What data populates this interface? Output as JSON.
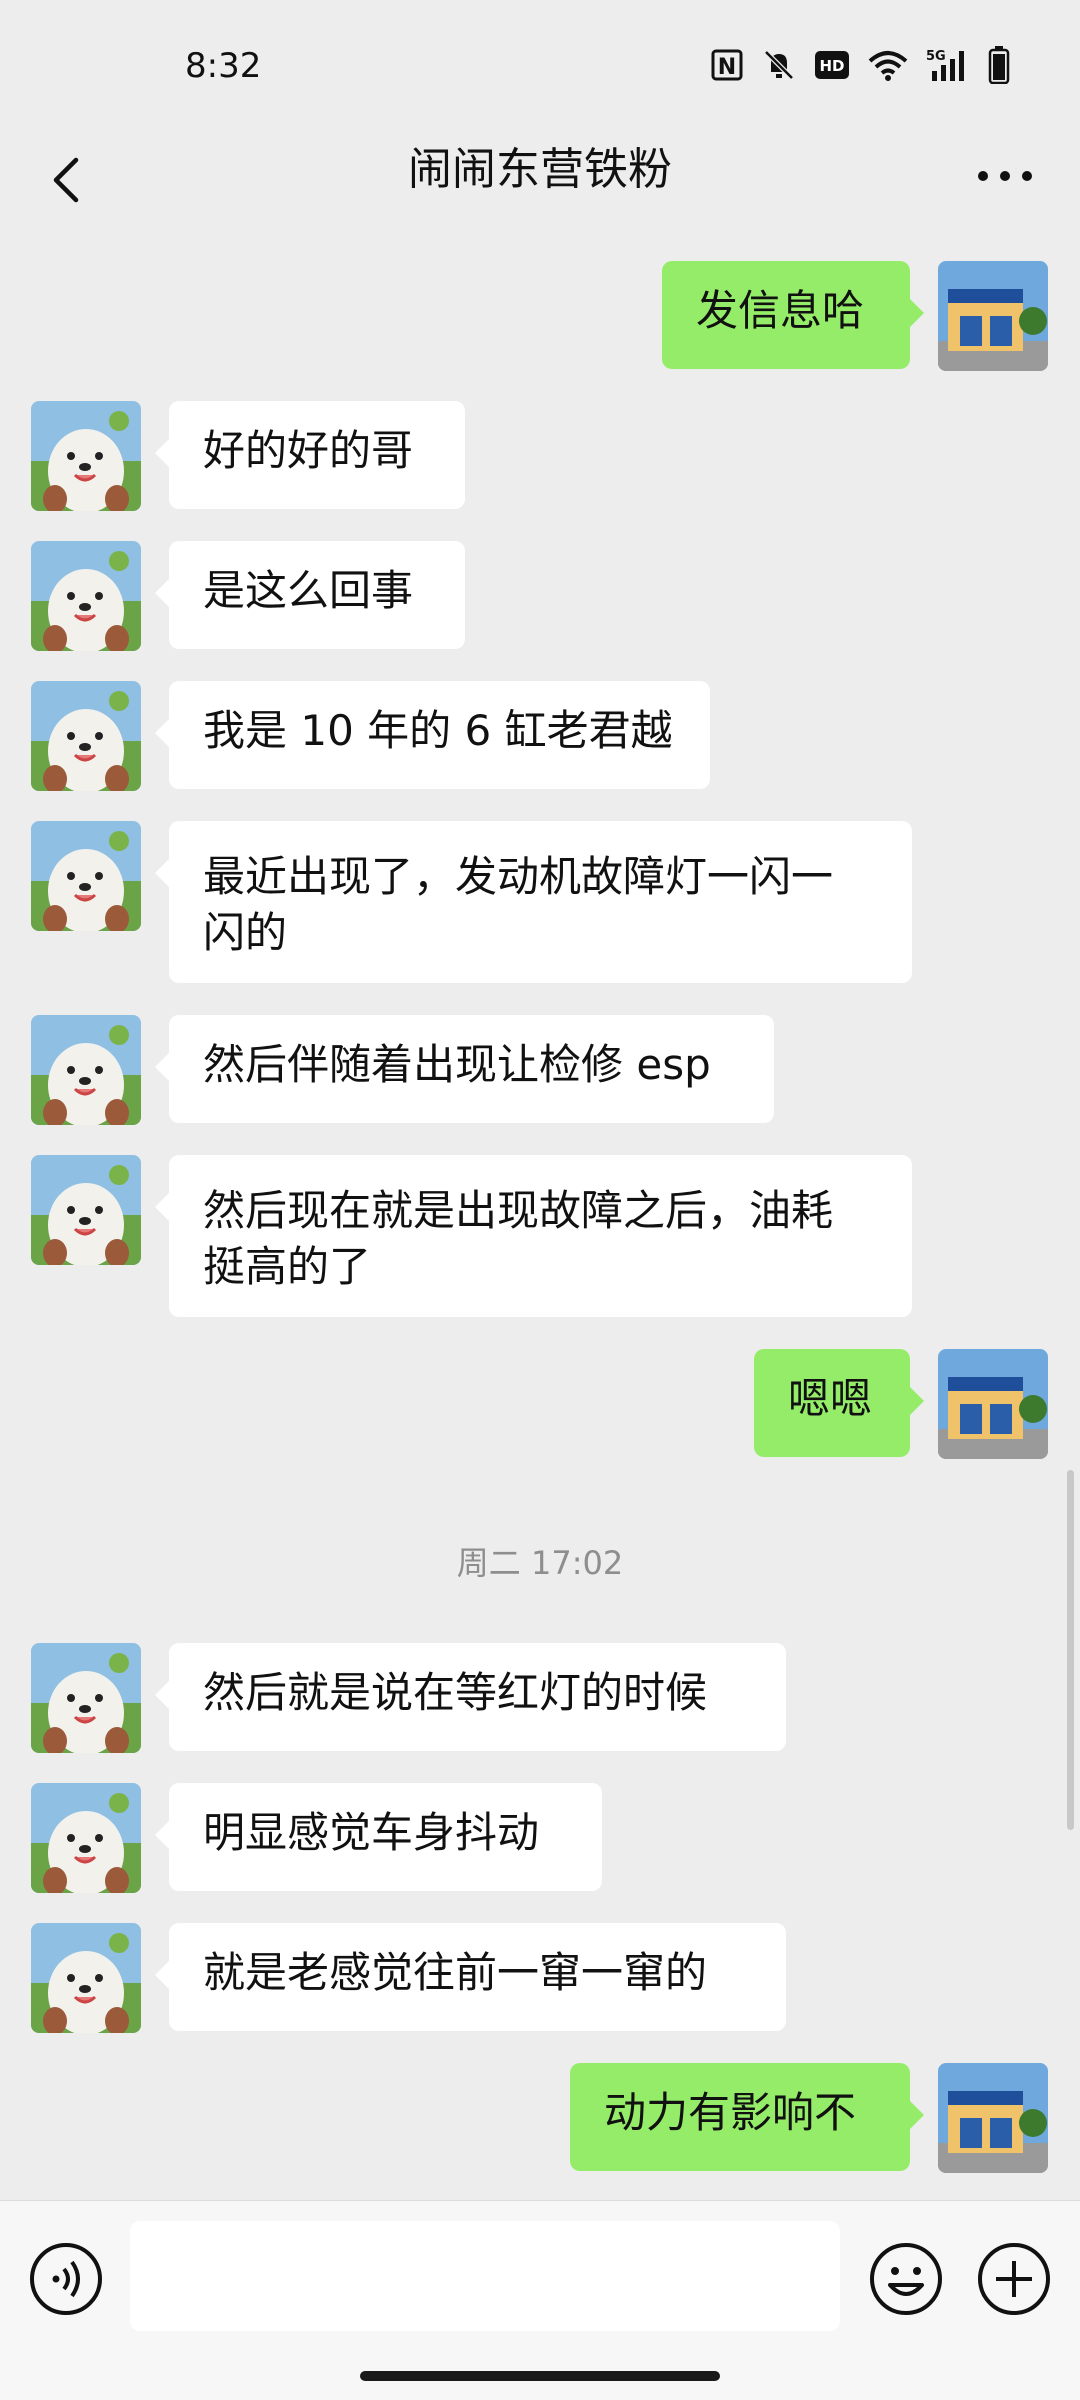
{
  "status_bar": {
    "time": "8:32",
    "icons": [
      "nfc-icon",
      "mute-icon",
      "hd-icon",
      "wifi-icon",
      "5g-signal-icon",
      "battery-icon"
    ]
  },
  "header": {
    "title": "闹闹东营铁粉",
    "back_icon": "chevron-left-icon",
    "more_icon": "more-dots-icon"
  },
  "timestamp": "周二 17:02",
  "messages": [
    {
      "sender": "me",
      "text": "发信息哈"
    },
    {
      "sender": "other",
      "text": "好的好的哥"
    },
    {
      "sender": "other",
      "text": "是这么回事"
    },
    {
      "sender": "other",
      "text": "我是 10 年的 6 缸老君越"
    },
    {
      "sender": "other",
      "line1": "最近出现了，发动机故障灯一闪一",
      "line2": "闪的"
    },
    {
      "sender": "other",
      "text": "然后伴随着出现让检修 esp"
    },
    {
      "sender": "other",
      "line1": "然后现在就是出现故障之后，油耗",
      "line2": "挺高的了"
    },
    {
      "sender": "me",
      "text": "嗯嗯"
    },
    {
      "sender": "other",
      "text": "然后就是说在等红灯的时候"
    },
    {
      "sender": "other",
      "text": "明显感觉车身抖动"
    },
    {
      "sender": "other",
      "text": "就是老感觉往前一窜一窜的"
    },
    {
      "sender": "me",
      "text": "动力有影响不"
    }
  ],
  "input_bar": {
    "voice_icon": "voice-icon",
    "placeholder": "",
    "emoji_icon": "emoji-icon",
    "plus_icon": "plus-icon"
  },
  "colors": {
    "background": "#ededed",
    "my_bubble": "#95ec69",
    "their_bubble": "#ffffff"
  }
}
